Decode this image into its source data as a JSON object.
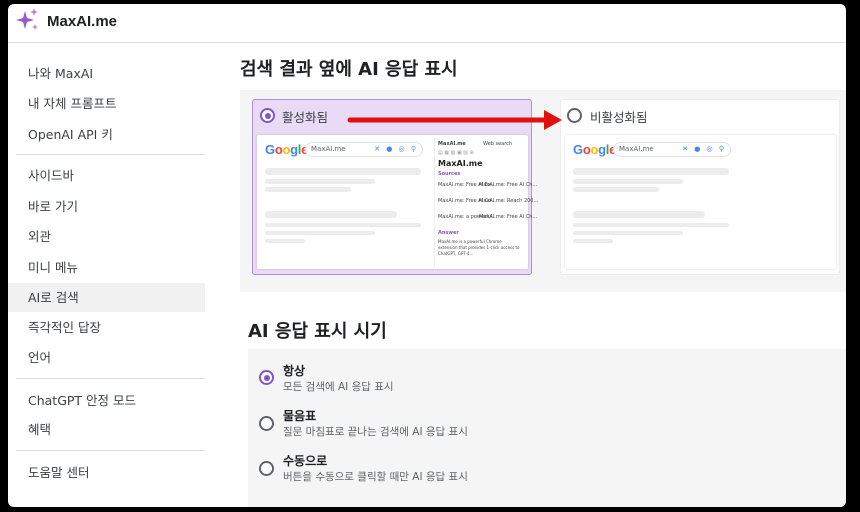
{
  "app": {
    "title": "MaxAI.me",
    "logo_icon": "sparkle-icon",
    "accent": "#9b59d0"
  },
  "sidebar": {
    "items": [
      {
        "label": "나와 MaxAI"
      },
      {
        "label": "내 자체 프롬프트"
      },
      {
        "label": "OpenAI API 키"
      },
      {
        "label": "사이드바"
      },
      {
        "label": "바로 가기"
      },
      {
        "label": "외관"
      },
      {
        "label": "미니 메뉴"
      },
      {
        "label": "AI로 검색",
        "active": true
      },
      {
        "label": "즉각적인 답장"
      },
      {
        "label": "언어"
      },
      {
        "label": "ChatGPT 안정 모드"
      },
      {
        "label": "혜택"
      },
      {
        "label": "도움말 센터"
      }
    ]
  },
  "main": {
    "section1": {
      "title": "검색 결과 옆에 AI 응답 표시",
      "options": [
        {
          "label": "활성화됨",
          "checked": true
        },
        {
          "label": "비활성화됨",
          "checked": false
        }
      ],
      "preview": {
        "google_logo": "Google",
        "search_query": "MaxAI.me",
        "panel_header": "MaxAI.me",
        "panel_model": "Web search",
        "panel_title": "MaxAI.me",
        "sources_label": "Sources",
        "answer_label": "Answer",
        "source_cards": [
          "MaxAI.me: Free AI Ex...",
          "MaxAI.me: Free AI Ch...",
          "MaxAI.me: Free AI Co...",
          "MaxAI.me: Reach 200...",
          "MaxAI.me: a powerful...",
          "MaxAI.me: Free AI Ch..."
        ],
        "answer_text": "MaxAI.me is a powerful Chrome extension that provides 1-click access to ChatGPT, GPT-4..."
      }
    },
    "section2": {
      "title": "AI 응답 표시 시기",
      "options": [
        {
          "title": "항상",
          "desc": "모든 검색에 AI 응답 표시",
          "checked": true
        },
        {
          "title": "물음표",
          "desc": "질문 마침표로 끝나는 검색에 AI 응답 표시",
          "checked": false
        },
        {
          "title": "수동으로",
          "desc": "버튼을 수동으로 클릭할 때만 AI 응답 표시",
          "checked": false
        }
      ]
    }
  },
  "colors": {
    "radio_checked": "#7e57c2",
    "selected_card_bg": "#e9dbf6",
    "arrow": "#e01010"
  }
}
